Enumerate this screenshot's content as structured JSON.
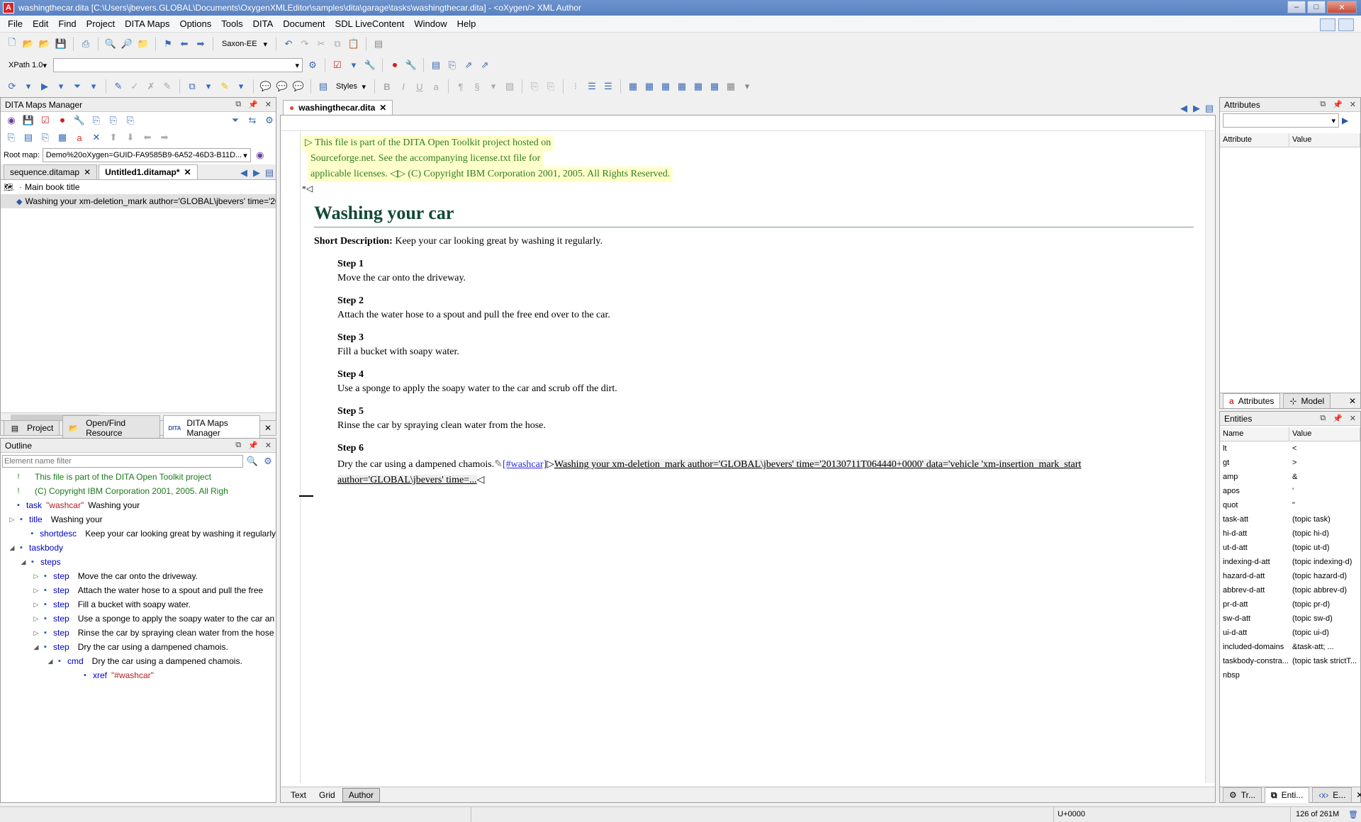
{
  "window": {
    "title": "washingthecar.dita [C:\\Users\\jbevers.GLOBAL\\Documents\\OxygenXMLEditor\\samples\\dita\\garage\\tasks\\washingthecar.dita] - <oXygen/> XML Author",
    "min": "–",
    "max": "□",
    "close": "✕",
    "app_icon": "A"
  },
  "menubar": {
    "items": [
      "File",
      "Edit",
      "Find",
      "Project",
      "DITA Maps",
      "Options",
      "Tools",
      "DITA",
      "Document",
      "SDL LiveContent",
      "Window",
      "Help"
    ]
  },
  "toolbar": {
    "transformer": "Saxon-EE",
    "xpath_version": "XPath 1.0",
    "xpath_query": "",
    "styles_label": "Styles"
  },
  "ditamaps": {
    "title": "DITA Maps Manager",
    "rootmap_label": "Root map:",
    "rootmap_value": "Demo%20oXygen=GUID-FA9585B9-6A52-46D3-B11D...",
    "tabs": [
      "sequence.ditamap",
      "Untitled1.ditamap*"
    ],
    "tree": [
      {
        "text": "Main book title"
      },
      {
        "text": "Washing your xm-deletion_mark author='GLOBAL\\jbevers' time='201"
      }
    ]
  },
  "leftbottomtabs": [
    "Project",
    "Open/Find Resource",
    "DITA Maps Manager"
  ],
  "outline": {
    "title": "Outline",
    "filter_placeholder": "Element name filter",
    "rows": [
      {
        "tag": "",
        "attr": "",
        "text": "This file is part of the DITA Open Toolkit project",
        "comment": true
      },
      {
        "tag": "",
        "attr": "",
        "text": "(C) Copyright IBM Corporation 2001, 2005. All Righ",
        "comment": true
      },
      {
        "tag": "task",
        "attr": "\"washcar\"",
        "text": "Washing your"
      },
      {
        "tag": "title",
        "attr": "",
        "text": "Washing your"
      },
      {
        "tag": "shortdesc",
        "attr": "",
        "text": "Keep your car looking great by washing it regularly"
      },
      {
        "tag": "taskbody",
        "attr": "",
        "text": ""
      },
      {
        "tag": "steps",
        "attr": "",
        "text": ""
      },
      {
        "tag": "step",
        "attr": "",
        "text": "Move the car onto the driveway."
      },
      {
        "tag": "step",
        "attr": "",
        "text": "Attach the water hose to a spout and pull the free"
      },
      {
        "tag": "step",
        "attr": "",
        "text": "Fill a bucket with soapy water."
      },
      {
        "tag": "step",
        "attr": "",
        "text": "Use a sponge to apply the soapy water to the car an"
      },
      {
        "tag": "step",
        "attr": "",
        "text": "Rinse the car by spraying clean water from the hose"
      },
      {
        "tag": "step",
        "attr": "",
        "text": "Dry the car using a dampened chamois."
      },
      {
        "tag": "cmd",
        "attr": "",
        "text": "Dry the car using a dampened chamois."
      },
      {
        "tag": "xref",
        "attr": "\"#washcar\"",
        "text": ""
      }
    ]
  },
  "editor": {
    "tab": "washingthecar.dita",
    "comment_line1": "This file is part of the DITA Open Toolkit project hosted on",
    "comment_line2": "Sourceforge.net. See the accompanying license.txt file for",
    "comment_line3": "applicable licenses.",
    "comment2": "(C) Copyright IBM Corporation 2001, 2005. All Rights Reserved.",
    "marker": "*",
    "doc_title": "Washing your car",
    "shortdesc_label": "Short Description:",
    "shortdesc_text": "Keep your car looking great by washing it regularly.",
    "steps": [
      {
        "label": "Step 1",
        "cmd": "Move the car onto the driveway."
      },
      {
        "label": "Step 2",
        "cmd": "Attach the water hose to a spout and pull the free end over to the car."
      },
      {
        "label": "Step 3",
        "cmd": "Fill a bucket with soapy water."
      },
      {
        "label": "Step 4",
        "cmd": "Use a sponge to apply the soapy water to the car and scrub off the dirt."
      },
      {
        "label": "Step 5",
        "cmd": "Rinse the car by spraying clean water from the hose."
      }
    ],
    "step6_label": "Step 6",
    "step6_cmd": "Dry the car using a dampened chamois.",
    "step6_xref": "[#washcar]",
    "step6_deletion_line1": "Washing your xm-deletion_mark author='GLOBAL\\jbevers' time='20130711T064440+0000' data='vehicle 'xm-insertion_mark_start",
    "step6_deletion_line2": "author='GLOBAL\\jbevers' time=...",
    "modes": [
      "Text",
      "Grid",
      "Author"
    ]
  },
  "attributes": {
    "title": "Attributes",
    "col_attr": "Attribute",
    "col_value": "Value",
    "tabs": [
      "Attributes",
      "Model"
    ]
  },
  "entities": {
    "title": "Entities",
    "col_name": "Name",
    "col_value": "Value",
    "rows": [
      [
        "lt",
        "<"
      ],
      [
        "gt",
        ">"
      ],
      [
        "amp",
        "&"
      ],
      [
        "apos",
        "'"
      ],
      [
        "quot",
        "\""
      ],
      [
        "task-att",
        "(topic task)"
      ],
      [
        "hi-d-att",
        "(topic hi-d)"
      ],
      [
        "ut-d-att",
        "(topic ut-d)"
      ],
      [
        "indexing-d-att",
        "(topic indexing-d)"
      ],
      [
        "hazard-d-att",
        "(topic hazard-d)"
      ],
      [
        "abbrev-d-att",
        "(topic abbrev-d)"
      ],
      [
        "pr-d-att",
        "(topic pr-d)"
      ],
      [
        "sw-d-att",
        "(topic sw-d)"
      ],
      [
        "ui-d-att",
        "(topic ui-d)"
      ],
      [
        "included-domains",
        "&task-att;      ..."
      ],
      [
        "taskbody-constra...",
        "(topic task strictT..."
      ],
      [
        "nbsp",
        ""
      ]
    ],
    "tabs": [
      "Tr...",
      "Enti...",
      "E..."
    ]
  },
  "status": {
    "unicode": "U+0000",
    "memory": "126 of 261M"
  }
}
